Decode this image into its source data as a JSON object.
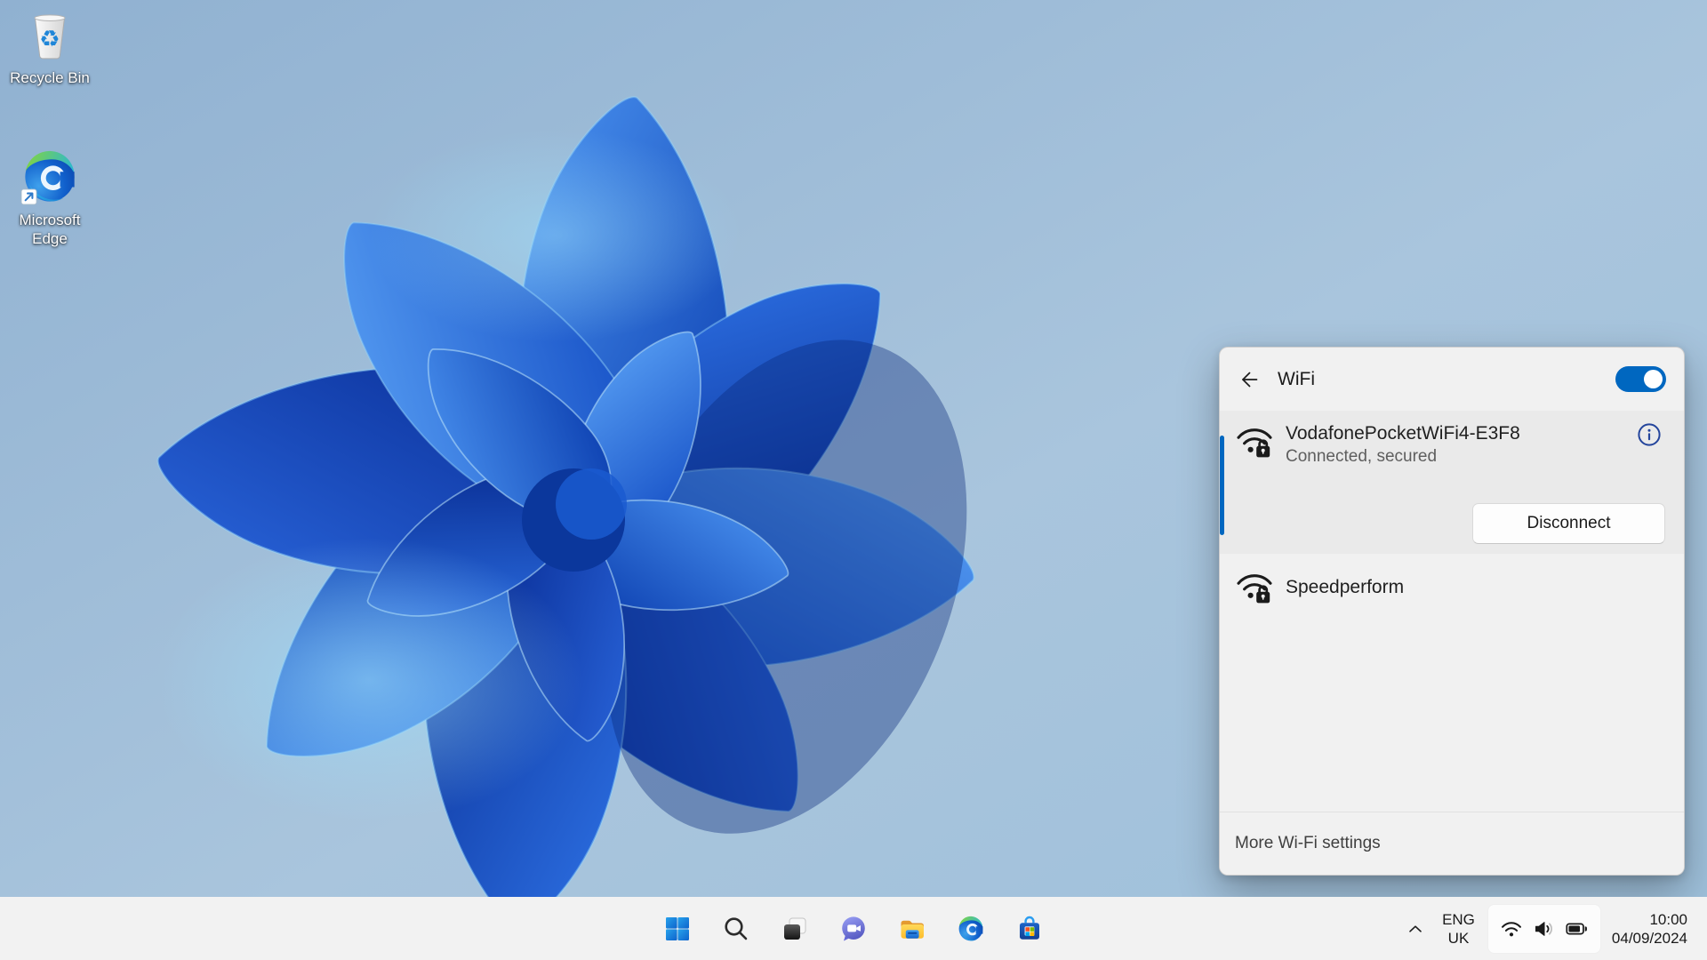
{
  "colors": {
    "accent": "#0067c0",
    "panel_bg": "#f1f1f1",
    "selected_item_bg": "#eaeaea",
    "taskbar_bg": "#f2f2f2"
  },
  "desktop": {
    "icons": [
      {
        "label": "Recycle Bin",
        "icon": "recycle-bin"
      },
      {
        "label": "Microsoft Edge",
        "icon": "edge-shortcut"
      }
    ]
  },
  "wifi_panel": {
    "title": "WiFi",
    "toggle": {
      "name": "wifi-toggle",
      "state": "on"
    },
    "networks": [
      {
        "name": "VodafonePocketWiFi4-E3F8",
        "status": "Connected, secured",
        "action": "Disconnect",
        "icon": "wifi-secured",
        "selected": true
      },
      {
        "name": "Speedperform",
        "icon": "wifi-secured",
        "selected": false
      }
    ],
    "footer": "More Wi-Fi settings"
  },
  "taskbar": {
    "buttons": [
      {
        "icon": "start"
      },
      {
        "icon": "search"
      },
      {
        "icon": "task-view"
      },
      {
        "icon": "chat"
      },
      {
        "icon": "file-explorer"
      },
      {
        "icon": "edge"
      },
      {
        "icon": "store"
      }
    ],
    "tray": {
      "chevron_icon": "chevron-up",
      "language": [
        "ENG",
        "UK"
      ],
      "status_icons": [
        "wifi",
        "volume",
        "battery"
      ],
      "time": "10:00",
      "date": "04/09/2024"
    }
  }
}
